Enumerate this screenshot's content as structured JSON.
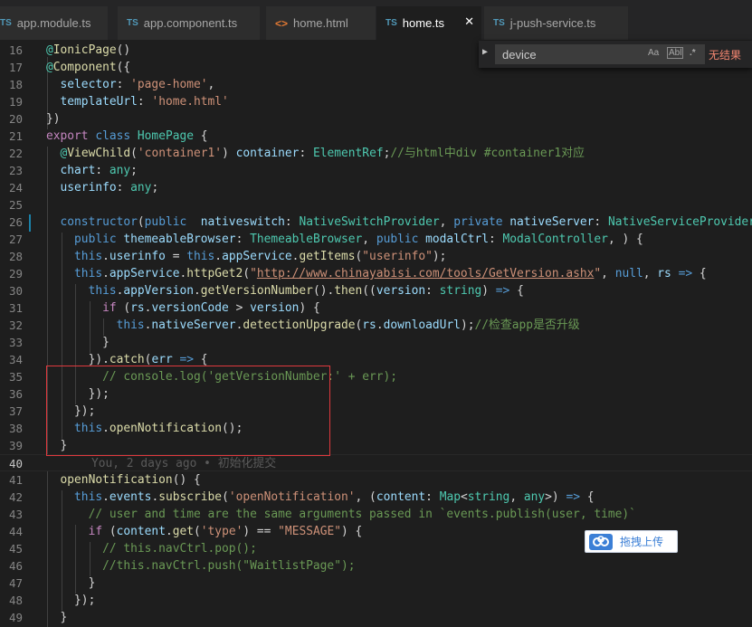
{
  "tabs": [
    {
      "icon": "TS",
      "label": "app.module.ts",
      "active": false
    },
    {
      "icon": "TS",
      "label": "app.component.ts",
      "active": false
    },
    {
      "icon": "<>",
      "label": "home.html",
      "active": false
    },
    {
      "icon": "TS",
      "label": "home.ts",
      "active": true,
      "close": "✕"
    },
    {
      "icon": "TS",
      "label": "j-push-service.ts",
      "active": false
    }
  ],
  "find": {
    "toggle": "▶",
    "query": "device",
    "match_case": "Aa",
    "whole_word": "Abl",
    "regex": ".*",
    "result": "无结果"
  },
  "editor": {
    "current_line": 40,
    "blame": "You, 2 days ago • 初始化提交",
    "lines": [
      {
        "n": 16,
        "code": [
          [
            "@",
            "ty"
          ],
          [
            "IonicPage",
            "fn"
          ],
          [
            "()",
            ""
          ]
        ]
      },
      {
        "n": 17,
        "code": [
          [
            "@",
            "ty"
          ],
          [
            "Component",
            "fn"
          ],
          [
            "({",
            ""
          ]
        ]
      },
      {
        "n": 18,
        "code": [
          [
            "  selector",
            "vr"
          ],
          [
            ": ",
            ""
          ],
          [
            "'page-home'",
            "str"
          ],
          [
            ",",
            ""
          ]
        ]
      },
      {
        "n": 19,
        "code": [
          [
            "  templateUrl",
            "vr"
          ],
          [
            ": ",
            ""
          ],
          [
            "'home.html'",
            "str"
          ]
        ]
      },
      {
        "n": 20,
        "code": [
          [
            "})",
            ""
          ]
        ]
      },
      {
        "n": 21,
        "code": [
          [
            "export ",
            "kc"
          ],
          [
            "class ",
            "kw"
          ],
          [
            "HomePage ",
            "ty"
          ],
          [
            "{",
            ""
          ]
        ]
      },
      {
        "n": 22,
        "code": [
          [
            "  @",
            "ty"
          ],
          [
            "ViewChild",
            "fn"
          ],
          [
            "(",
            ""
          ],
          [
            "'container1'",
            "str"
          ],
          [
            ") ",
            ""
          ],
          [
            "container",
            "vr"
          ],
          [
            ": ",
            ""
          ],
          [
            "ElementRef",
            "ty"
          ],
          [
            ";",
            ""
          ],
          [
            "//与html中div #container1对应",
            "cm"
          ]
        ]
      },
      {
        "n": 23,
        "code": [
          [
            "  chart",
            "vr"
          ],
          [
            ": ",
            ""
          ],
          [
            "any",
            "ty"
          ],
          [
            ";",
            ""
          ]
        ]
      },
      {
        "n": 24,
        "code": [
          [
            "  userinfo",
            "vr"
          ],
          [
            ": ",
            ""
          ],
          [
            "any",
            "ty"
          ],
          [
            ";",
            ""
          ]
        ]
      },
      {
        "n": 25,
        "code": []
      },
      {
        "n": 26,
        "code": [
          [
            "  constructor",
            "kw"
          ],
          [
            "(",
            ""
          ],
          [
            "public  ",
            "kw"
          ],
          [
            "nativeswitch",
            "vr"
          ],
          [
            ": ",
            ""
          ],
          [
            "NativeSwitchProvider",
            "ty"
          ],
          [
            ", ",
            ""
          ],
          [
            "private ",
            "kw"
          ],
          [
            "nativeServer",
            "vr"
          ],
          [
            ": ",
            ""
          ],
          [
            "NativeServiceProvider",
            "ty"
          ],
          [
            ",",
            ""
          ]
        ]
      },
      {
        "n": 27,
        "code": [
          [
            "    public ",
            "kw"
          ],
          [
            "themeableBrowser",
            "vr"
          ],
          [
            ": ",
            ""
          ],
          [
            "ThemeableBrowser",
            "ty"
          ],
          [
            ", ",
            ""
          ],
          [
            "public ",
            "kw"
          ],
          [
            "modalCtrl",
            "vr"
          ],
          [
            ": ",
            ""
          ],
          [
            "ModalController",
            "ty"
          ],
          [
            ", ) {",
            ""
          ]
        ]
      },
      {
        "n": 28,
        "code": [
          [
            "    this",
            "kw"
          ],
          [
            ".",
            ""
          ],
          [
            "userinfo",
            "vr"
          ],
          [
            " = ",
            ""
          ],
          [
            "this",
            "kw"
          ],
          [
            ".",
            ""
          ],
          [
            "appService",
            "vr"
          ],
          [
            ".",
            ""
          ],
          [
            "getItems",
            "fn"
          ],
          [
            "(",
            ""
          ],
          [
            "\"userinfo\"",
            "str"
          ],
          [
            ");",
            ""
          ]
        ]
      },
      {
        "n": 29,
        "code": [
          [
            "    this",
            "kw"
          ],
          [
            ".",
            ""
          ],
          [
            "appService",
            "vr"
          ],
          [
            ".",
            ""
          ],
          [
            "httpGet2",
            "fn"
          ],
          [
            "(",
            ""
          ],
          [
            "\"",
            "str"
          ],
          [
            "http://www.chinayabisi.com/tools/GetVersion.ashx",
            "url"
          ],
          [
            "\"",
            "str"
          ],
          [
            ", ",
            ""
          ],
          [
            "null",
            "kw"
          ],
          [
            ", ",
            ""
          ],
          [
            "rs",
            "vr"
          ],
          [
            " ",
            ""
          ],
          [
            "=>",
            "kw"
          ],
          [
            " {",
            ""
          ]
        ]
      },
      {
        "n": 30,
        "code": [
          [
            "      this",
            "kw"
          ],
          [
            ".",
            ""
          ],
          [
            "appVersion",
            "vr"
          ],
          [
            ".",
            ""
          ],
          [
            "getVersionNumber",
            "fn"
          ],
          [
            "().",
            ""
          ],
          [
            "then",
            "fn"
          ],
          [
            "((",
            ""
          ],
          [
            "version",
            "vr"
          ],
          [
            ": ",
            ""
          ],
          [
            "string",
            "ty"
          ],
          [
            ") ",
            ""
          ],
          [
            "=>",
            "kw"
          ],
          [
            " {",
            ""
          ]
        ]
      },
      {
        "n": 31,
        "code": [
          [
            "        if ",
            "kc"
          ],
          [
            "(",
            ""
          ],
          [
            "rs",
            "vr"
          ],
          [
            ".",
            ""
          ],
          [
            "versionCode",
            "vr"
          ],
          [
            " > ",
            ""
          ],
          [
            "version",
            "vr"
          ],
          [
            ") {",
            ""
          ]
        ]
      },
      {
        "n": 32,
        "code": [
          [
            "          this",
            "kw"
          ],
          [
            ".",
            ""
          ],
          [
            "nativeServer",
            "vr"
          ],
          [
            ".",
            ""
          ],
          [
            "detectionUpgrade",
            "fn"
          ],
          [
            "(",
            ""
          ],
          [
            "rs",
            "vr"
          ],
          [
            ".",
            ""
          ],
          [
            "downloadUrl",
            "vr"
          ],
          [
            ");",
            ""
          ],
          [
            "//检查app是否升级",
            "cm"
          ]
        ]
      },
      {
        "n": 33,
        "code": [
          [
            "        }",
            ""
          ]
        ]
      },
      {
        "n": 34,
        "code": [
          [
            "      }).",
            ""
          ],
          [
            "catch",
            "fn"
          ],
          [
            "(",
            ""
          ],
          [
            "err",
            "vr"
          ],
          [
            " ",
            ""
          ],
          [
            "=>",
            "kw"
          ],
          [
            " {",
            ""
          ]
        ]
      },
      {
        "n": 35,
        "code": [
          [
            "        // console.log('getVersionNumber:' + err);",
            "cm"
          ]
        ]
      },
      {
        "n": 36,
        "code": [
          [
            "      });",
            ""
          ]
        ]
      },
      {
        "n": 37,
        "code": [
          [
            "    });",
            ""
          ]
        ]
      },
      {
        "n": 38,
        "code": [
          [
            "    this",
            "kw"
          ],
          [
            ".",
            ""
          ],
          [
            "openNotification",
            "fn"
          ],
          [
            "();",
            ""
          ]
        ]
      },
      {
        "n": 39,
        "code": [
          [
            "  }",
            ""
          ]
        ]
      },
      {
        "n": 40,
        "code": []
      },
      {
        "n": 41,
        "code": [
          [
            "  openNotification",
            "fn"
          ],
          [
            "() {",
            ""
          ]
        ]
      },
      {
        "n": 42,
        "code": [
          [
            "    this",
            "kw"
          ],
          [
            ".",
            ""
          ],
          [
            "events",
            "vr"
          ],
          [
            ".",
            ""
          ],
          [
            "subscribe",
            "fn"
          ],
          [
            "(",
            ""
          ],
          [
            "'openNotification'",
            "str"
          ],
          [
            ", (",
            ""
          ],
          [
            "content",
            "vr"
          ],
          [
            ": ",
            ""
          ],
          [
            "Map",
            "ty"
          ],
          [
            "<",
            ""
          ],
          [
            "string",
            "ty"
          ],
          [
            ", ",
            ""
          ],
          [
            "any",
            "ty"
          ],
          [
            ">) ",
            ""
          ],
          [
            "=>",
            "kw"
          ],
          [
            " {",
            ""
          ]
        ]
      },
      {
        "n": 43,
        "code": [
          [
            "      // user and time are the same arguments passed in `events.publish(user, time)`",
            "cm"
          ]
        ]
      },
      {
        "n": 44,
        "code": [
          [
            "      if ",
            "kc"
          ],
          [
            "(",
            ""
          ],
          [
            "content",
            "vr"
          ],
          [
            ".",
            ""
          ],
          [
            "get",
            "fn"
          ],
          [
            "(",
            ""
          ],
          [
            "'type'",
            "str"
          ],
          [
            ") == ",
            ""
          ],
          [
            "\"MESSAGE\"",
            "str"
          ],
          [
            ") {",
            ""
          ]
        ]
      },
      {
        "n": 45,
        "code": [
          [
            "        // this.navCtrl.pop();",
            "cm"
          ]
        ]
      },
      {
        "n": 46,
        "code": [
          [
            "        //this.navCtrl.push(\"WaitlistPage\");",
            "cm"
          ]
        ]
      },
      {
        "n": 47,
        "code": [
          [
            "      }",
            ""
          ]
        ]
      },
      {
        "n": 48,
        "code": [
          [
            "    });",
            ""
          ]
        ]
      },
      {
        "n": 49,
        "code": [
          [
            "  }",
            ""
          ]
        ]
      }
    ]
  },
  "upload_button": {
    "label": "拖拽上传",
    "icon": "baidu-cloud-icon"
  },
  "colors": {
    "keyword": "#569cd6",
    "control": "#c586c0",
    "string": "#ce9178",
    "comment": "#6a9955",
    "function": "#dcdcaa",
    "type": "#4ec9b0",
    "variable": "#9cdcfe",
    "highlight_box": "#e0393e"
  }
}
